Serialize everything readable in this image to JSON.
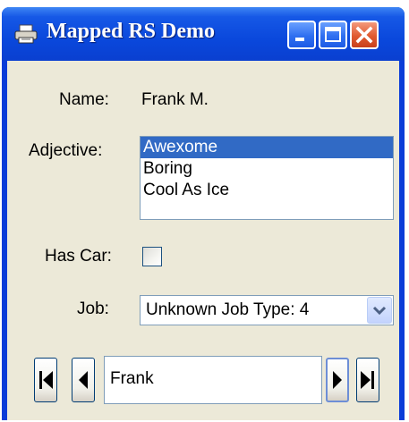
{
  "window": {
    "title": "Mapped RS Demo",
    "icons": {
      "app": "printer-icon",
      "minimize": "minimize-icon",
      "maximize": "maximize-icon",
      "close": "close-icon"
    }
  },
  "form": {
    "name_label": "Name:",
    "name_value": "Frank M.",
    "adjective_label": "Adjective:",
    "adjective_options": [
      {
        "label": "Awexome",
        "selected": true
      },
      {
        "label": "Boring",
        "selected": false
      },
      {
        "label": "Cool As Ice",
        "selected": false
      }
    ],
    "has_car_label": "Has Car:",
    "has_car_checked": false,
    "job_label": "Job:",
    "job_value": "Unknown Job Type: 4"
  },
  "navigator": {
    "current_record": "Frank",
    "icons": {
      "first": "first-record-icon",
      "prev": "previous-record-icon",
      "next": "next-record-icon",
      "last": "last-record-icon"
    }
  },
  "colors": {
    "titlebar": "#0a48dc",
    "client_bg": "#ece9d8",
    "selection": "#316ac5",
    "close_button": "#e05a30"
  }
}
